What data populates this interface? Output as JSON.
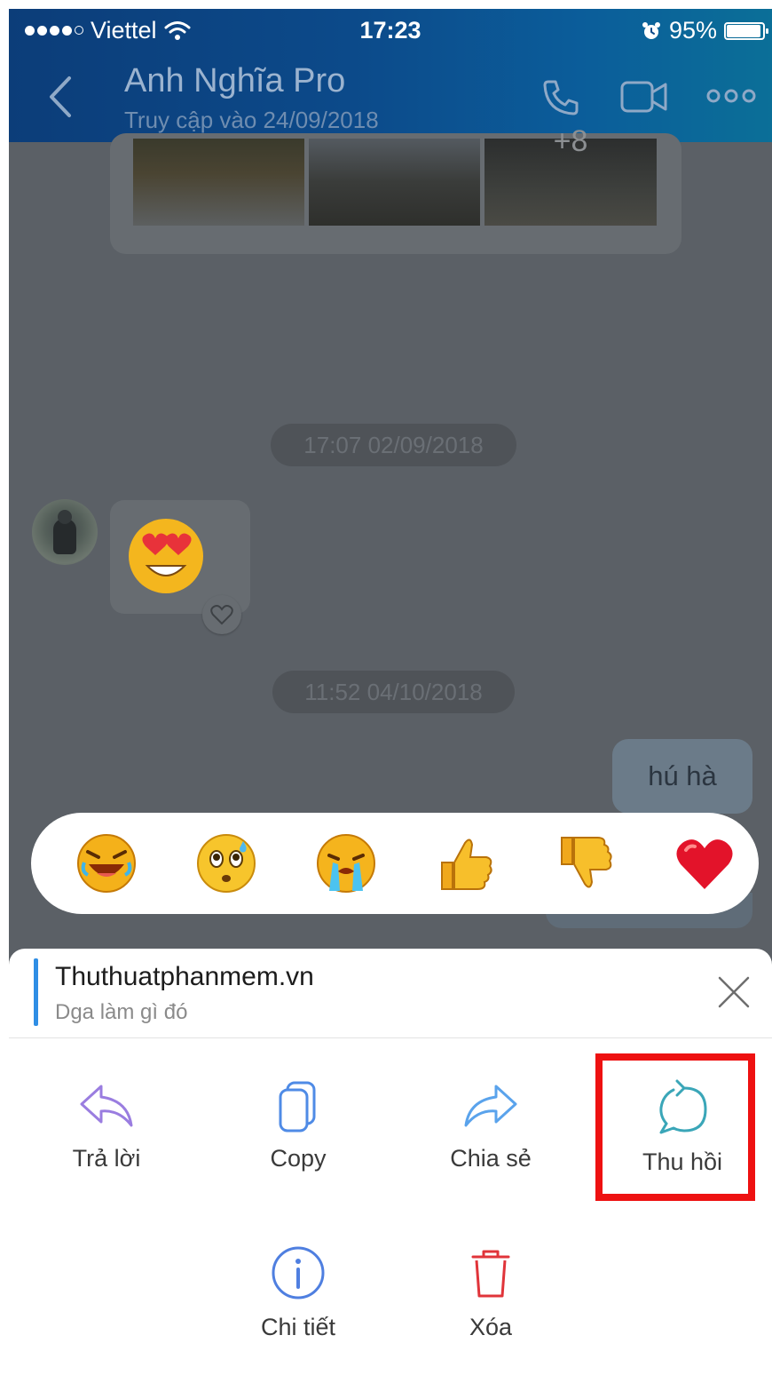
{
  "status_bar": {
    "carrier": "Viettel",
    "time": "17:23",
    "battery": "95%"
  },
  "header": {
    "contact_name": "Anh Nghĩa Pro",
    "last_seen": "Truy cập vào 24/09/2018",
    "album_more": "+8"
  },
  "chat": {
    "timestamps": [
      "17:07 02/09/2018",
      "11:52 04/10/2018"
    ],
    "outgoing_message": "hú hà"
  },
  "reactions": [
    "laugh-emoji",
    "worried-sweat-emoji",
    "crying-emoji",
    "thumbs-up-emoji",
    "thumbs-down-emoji",
    "heart-emoji"
  ],
  "sheet": {
    "quote_title": "Thuthuatphanmem.vn",
    "quote_text": "Dga làm gì đó",
    "actions": {
      "reply": "Trả lời",
      "copy": "Copy",
      "share": "Chia sẻ",
      "recall": "Thu hồi",
      "details": "Chi tiết",
      "delete": "Xóa"
    }
  },
  "colors": {
    "header_gradient_start": "#0c3d79",
    "header_gradient_end": "#0b6f98",
    "quote_accent": "#2f8ee5",
    "highlight_border": "#ee1111",
    "recall_icon": "#3aa6b8"
  }
}
